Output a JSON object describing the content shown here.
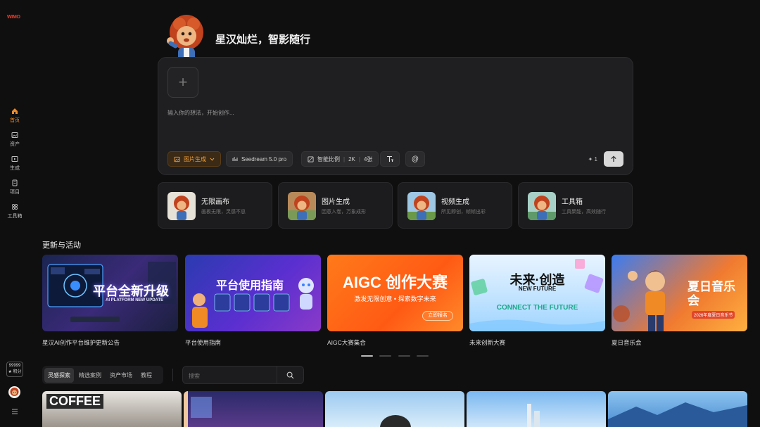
{
  "app": {
    "logo_text": "WIMO"
  },
  "sidebar": {
    "items": [
      {
        "label": "首页",
        "icon": "home-icon"
      },
      {
        "label": "资产",
        "icon": "image-icon"
      },
      {
        "label": "生成",
        "icon": "play-icon"
      },
      {
        "label": "项目",
        "icon": "document-icon"
      },
      {
        "label": "工具箱",
        "icon": "grid-icon"
      }
    ],
    "active_index": 0,
    "points_value": "99999",
    "points_label": "★ 积分"
  },
  "hero": {
    "title": "星汉灿烂，智影随行"
  },
  "prompt": {
    "placeholder": "输入你的想法，开始创作...",
    "mode_label": "图片生成",
    "model_label": "Seedream 5.0 pro",
    "ratio_label": "智能比例",
    "resolution_label": "2K",
    "count_label": "4张",
    "cost_text": "1"
  },
  "features": [
    {
      "title": "无限画布",
      "subtitle": "画板无限，灵感不息"
    },
    {
      "title": "图片生成",
      "subtitle": "因意入卷，万象成形"
    },
    {
      "title": "视频生成",
      "subtitle": "所见即创，帧帧出彩"
    },
    {
      "title": "工具箱",
      "subtitle": "工具聚能，高效随行"
    }
  ],
  "updates": {
    "section_title": "更新与活动",
    "banners": [
      {
        "headline": "平台全新升级",
        "sub": "AI PLATFORM NEW UPDATE",
        "caption": "星汉AI创作平台维护更新公告"
      },
      {
        "headline": "平台使用指南",
        "sub": "",
        "caption": "平台使用指南"
      },
      {
        "headline": "AIGC 创作大赛",
        "sub": "激发无限创意 • 探索数字未来",
        "button": "立即报名",
        "caption": "AIGC大赛集合"
      },
      {
        "headline": "未来·创造",
        "sub": "NEW FUTURE",
        "sub2": "CONNECT THE FUTURE",
        "caption": "未来创新大赛"
      },
      {
        "headline": "夏日音乐会",
        "sub": "2026年度夏日音乐节",
        "caption": "夏日音乐会"
      }
    ],
    "dots": 4,
    "active_dot": 0
  },
  "explore": {
    "tabs": [
      "灵感探索",
      "精选案例",
      "资产市场",
      "教程"
    ],
    "active_tab": 0,
    "search_placeholder": "搜索"
  },
  "gallery": [
    {
      "label": "COFFEE"
    },
    {
      "label": ""
    },
    {
      "label": ""
    },
    {
      "label": ""
    },
    {
      "label": ""
    }
  ],
  "colors": {
    "accent": "#f08a24",
    "background": "#0f0f10",
    "panel": "#1f1f21"
  }
}
